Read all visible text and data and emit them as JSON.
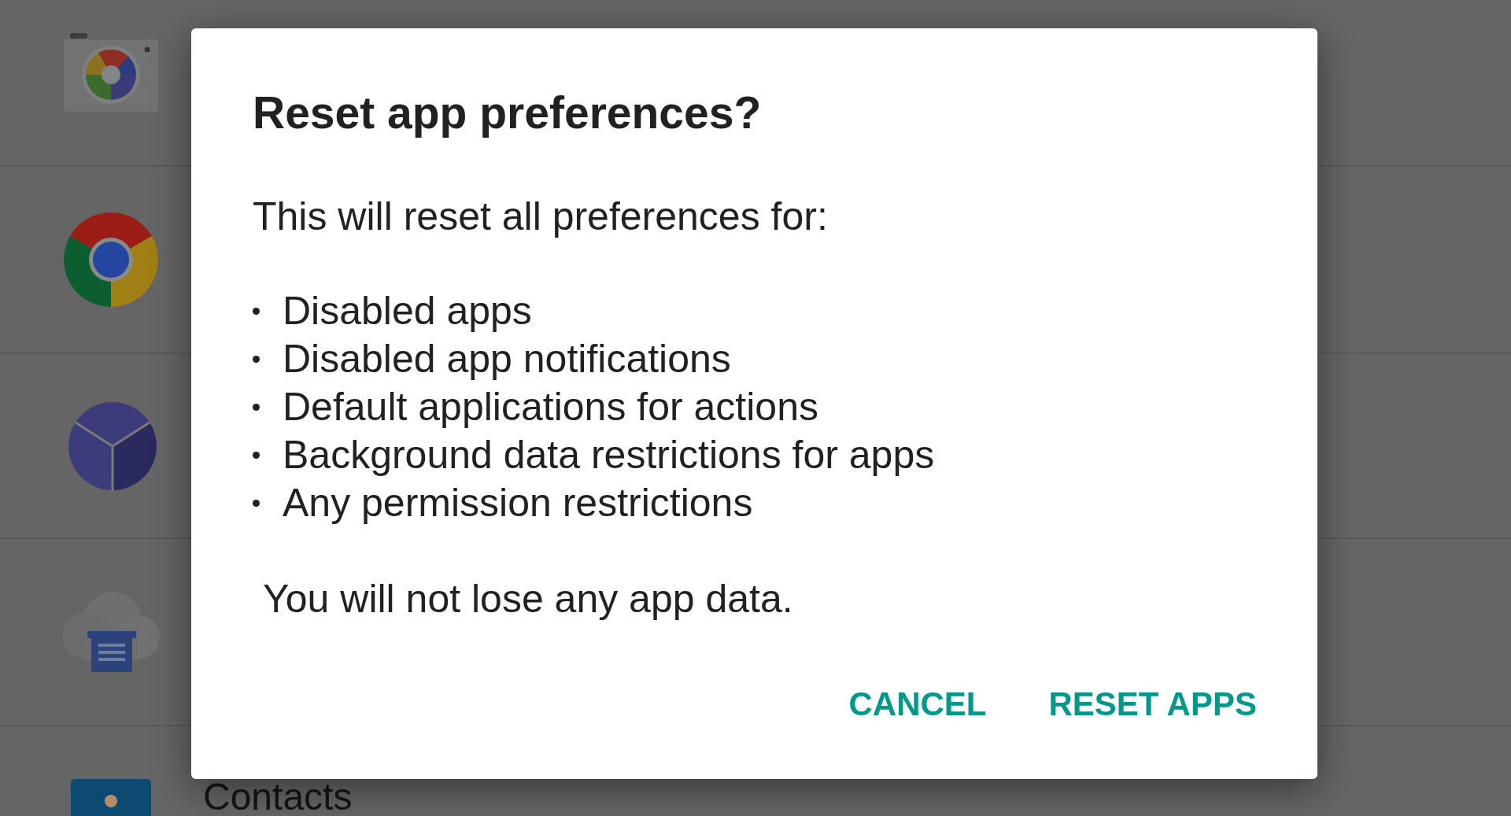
{
  "app_list": {
    "last_row_label": "Contacts"
  },
  "dialog": {
    "title": "Reset app preferences?",
    "intro": "This will reset all preferences for:",
    "items": [
      "Disabled apps",
      "Disabled app notifications",
      "Default applications for actions",
      "Background data restrictions for apps",
      "Any permission restrictions"
    ],
    "note": "You will not lose any app data.",
    "buttons": [
      {
        "label": "CANCEL"
      },
      {
        "label": "RESET APPS"
      }
    ]
  }
}
